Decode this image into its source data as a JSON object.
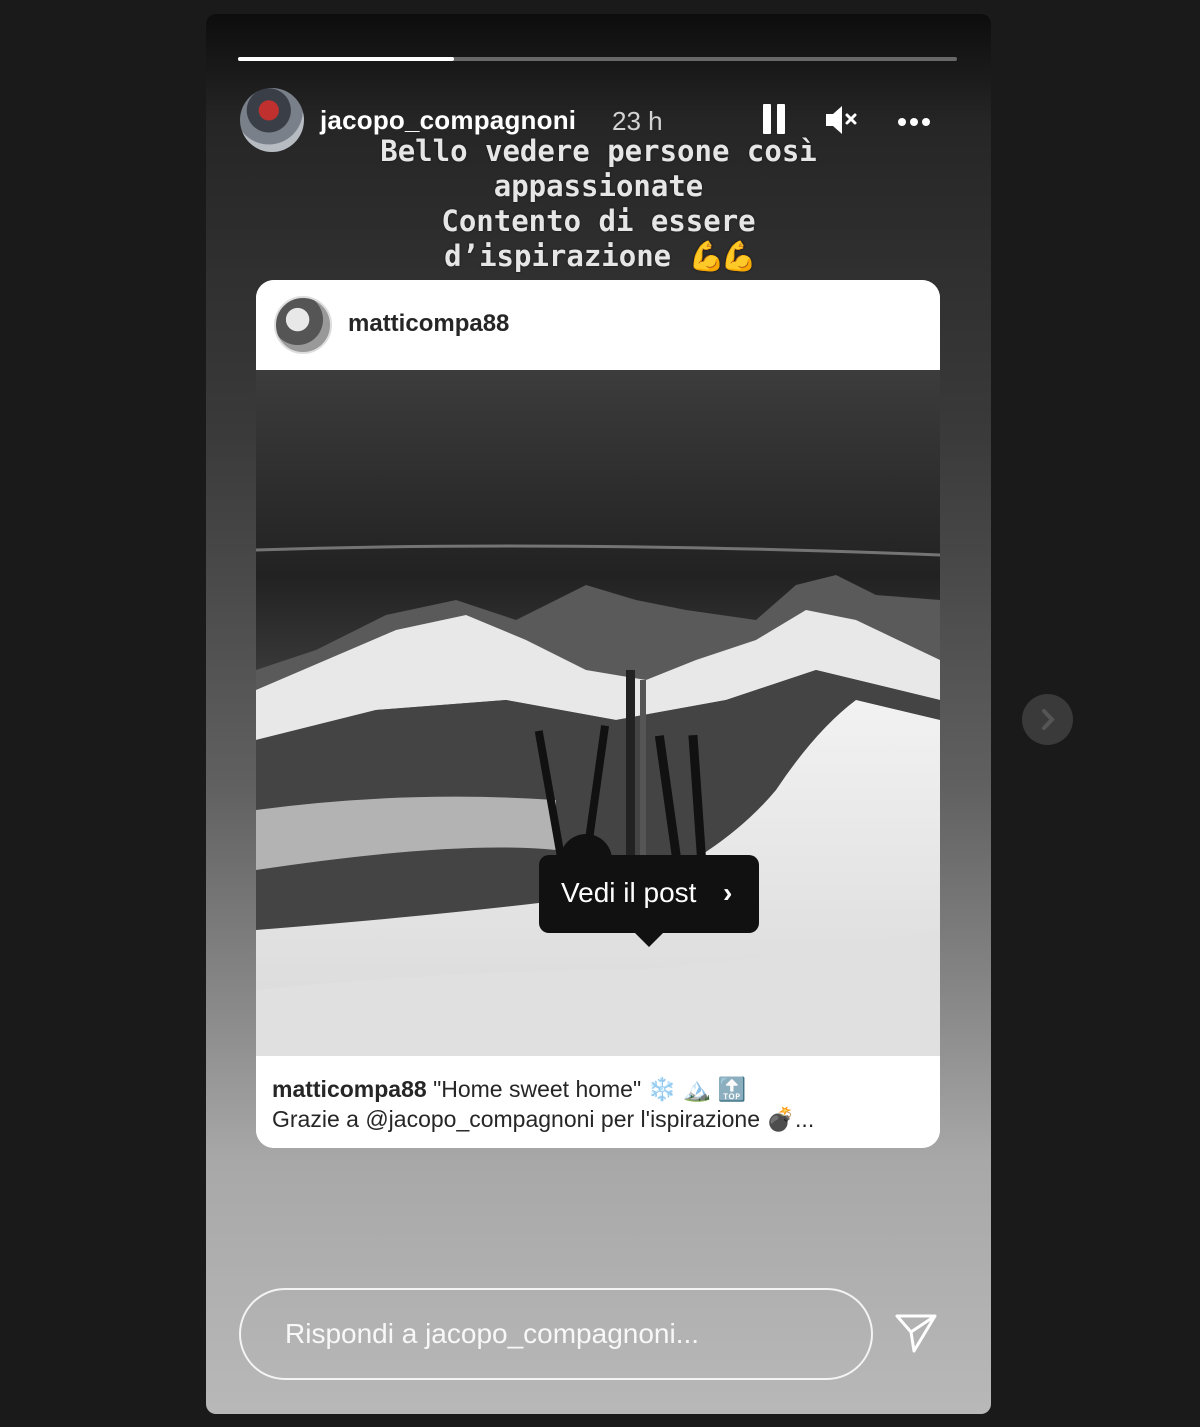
{
  "story": {
    "progress_fraction": 0.3,
    "username": "jacopo_compagnoni",
    "time": "23 h",
    "caption_lines": [
      "Bello vedere persone così",
      "appassionate",
      "Contento di essere",
      "d’ispirazione"
    ],
    "caption_emoji": "💪💪"
  },
  "post": {
    "username": "matticompa88",
    "caption_user": "matticompa88",
    "caption_text": "\"Home sweet home\" ❄️ 🏔️ 🔝",
    "caption_line2": "Grazie a @jacopo_compagnoni per l'ispirazione 💣...",
    "view_post_label": "Vedi il post",
    "view_post_chevron": "›"
  },
  "reply": {
    "placeholder": "Rispondi a jacopo_compagnoni..."
  },
  "icons": {
    "pause": "pause-icon",
    "mute": "mute-icon",
    "more": "more-icon",
    "send": "send-icon",
    "next": "chevron-right-icon"
  }
}
